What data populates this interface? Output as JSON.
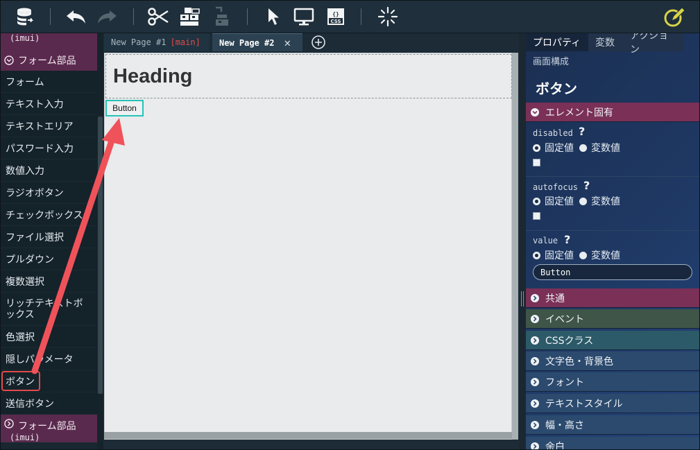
{
  "toolbar": {
    "icons": [
      "database-export-icon",
      "undo-icon",
      "redo-icon",
      "cut-icon",
      "copy-structure-icon",
      "paste-structure-icon",
      "select-pointer-icon",
      "preview-monitor-icon",
      "css-file-icon",
      "loading-spinner-icon",
      "edit-pencil-icon"
    ],
    "css_label": "CSS",
    "braces_label": "{}"
  },
  "sidebar": {
    "top_group_sub": "(imui)",
    "group_label": "フォーム部品",
    "items": [
      {
        "label": "フォーム"
      },
      {
        "label": "テキスト入力"
      },
      {
        "label": "テキストエリア"
      },
      {
        "label": "パスワード入力"
      },
      {
        "label": "数値入力"
      },
      {
        "label": "ラジオボタン"
      },
      {
        "label": "チェックボックス"
      },
      {
        "label": "ファイル選択"
      },
      {
        "label": "プルダウン"
      },
      {
        "label": "複数選択"
      },
      {
        "label": "リッチテキストボックス"
      },
      {
        "label": "色選択"
      },
      {
        "label": "隠しパラメータ"
      },
      {
        "label": "ボタン"
      },
      {
        "label": "送信ボタン"
      }
    ],
    "bottom_group_label": "フォーム部品",
    "bottom_group_sub": "(imui)"
  },
  "tabs": [
    {
      "label": "New Page #1",
      "branch": "[main]"
    },
    {
      "label": "New Page #2",
      "close": "✕"
    }
  ],
  "canvas": {
    "heading": "Heading",
    "button": "Button"
  },
  "right_panel": {
    "tabs": [
      "プロパティ",
      "変数",
      "アクション",
      "画面構成"
    ],
    "title": "ボタン",
    "section_element": "エレメント固有",
    "props": [
      {
        "name": "disabled",
        "fixed": "固定値",
        "variable": "変数値"
      },
      {
        "name": "autofocus",
        "fixed": "固定値",
        "variable": "変数値"
      },
      {
        "name": "value",
        "fixed": "固定値",
        "variable": "変数値",
        "input_value": "Button"
      }
    ],
    "question": "?",
    "sections": [
      {
        "label": "共通",
        "color": "#7a3057"
      },
      {
        "label": "イベント",
        "color": "#3e5548"
      },
      {
        "label": "CSSクラス",
        "color": "#2c5a68"
      },
      {
        "label": "文字色・背景色",
        "color": "#2b4a6e"
      },
      {
        "label": "フォント",
        "color": "#2b4a6e"
      },
      {
        "label": "テキストスタイル",
        "color": "#2b4a6e"
      },
      {
        "label": "幅・高さ",
        "color": "#2b4a6e"
      },
      {
        "label": "余白",
        "color": "#2b4a6e"
      }
    ]
  },
  "colors": {
    "accent_red": "#e24b4b",
    "selection_teal": "#26c3b8",
    "group_magenta": "#5a2a4e",
    "section_element": "#7a3057",
    "edit_icon_yellow": "#d9d34a"
  }
}
